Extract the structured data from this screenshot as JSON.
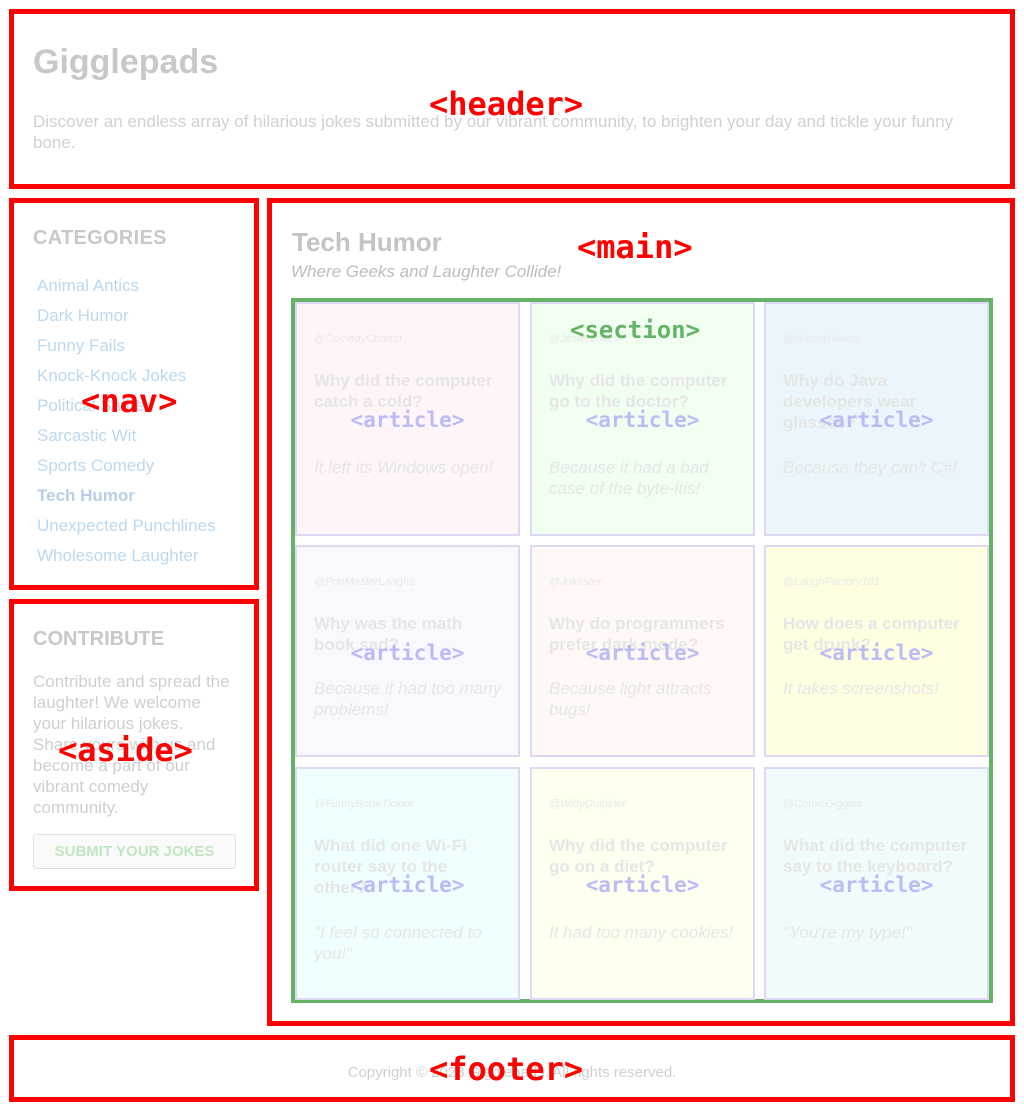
{
  "header": {
    "title": "Gigglepads",
    "tagline": "Discover an endless array of hilarious jokes submitted by our vibrant community, to brighten your day and tickle your funny bone.",
    "tag": "<header>"
  },
  "nav": {
    "heading": "CATEGORIES",
    "tag": "<nav>",
    "items": [
      {
        "label": "Animal Antics"
      },
      {
        "label": "Dark Humor"
      },
      {
        "label": "Funny Fails"
      },
      {
        "label": "Knock-Knock Jokes"
      },
      {
        "label": "Political Satire"
      },
      {
        "label": "Sarcastic Wit"
      },
      {
        "label": "Sports Comedy"
      },
      {
        "label": "Tech Humor"
      },
      {
        "label": "Unexpected Punchlines"
      },
      {
        "label": "Wholesome Laughter"
      }
    ],
    "active_index": 7
  },
  "aside": {
    "heading": "CONTRIBUTE",
    "text": "Contribute and spread the laughter! We welcome your hilarious jokes. Share yours with us and become a part of our vibrant comedy community.",
    "button_label": "SUBMIT YOUR JOKES",
    "tag": "<aside>"
  },
  "main": {
    "title": "Tech Humor",
    "subtitle": "Where Geeks and Laughter Collide!",
    "tag": "<main>",
    "section_tag": "<section>",
    "article_tag": "<article>",
    "jokes": [
      {
        "author": "@ComedyChamp",
        "question": "Why did the computer catch a cold?",
        "answer": "It left its Windows open!",
        "bg": "#fff5f8"
      },
      {
        "author": "@JesterJokes",
        "question": "Why did the computer go to the doctor?",
        "answer": "Because it had a bad case of the byte-itis!",
        "bg": "#f0fff0"
      },
      {
        "author": "@HumorHavoc",
        "question": "Why do Java developers wear glasses?",
        "answer": "Because they can't C#!",
        "bg": "#eaf6fc"
      },
      {
        "author": "@PunMasterLaughs",
        "question": "Why was the math book sad?",
        "answer": "Because it had too many problems!",
        "bg": "#f9f8ff"
      },
      {
        "author": "@Jokester",
        "question": "Why do programmers prefer dark mode?",
        "answer": "Because light attracts bugs!",
        "bg": "#fff8f4"
      },
      {
        "author": "@LaughFactory101",
        "question": "How does a computer get drunk?",
        "answer": "It takes screenshots!",
        "bg": "#fffee0"
      },
      {
        "author": "@FunnyBoneTickler",
        "question": "What did one Wi-Fi router say to the other?",
        "answer": "\"I feel so connected to you!\"",
        "bg": "#effeff"
      },
      {
        "author": "@WittyQuipster",
        "question": "Why did the computer go on a diet?",
        "answer": "It had too many cookies!",
        "bg": "#fffff0"
      },
      {
        "author": "@ComicGiggles",
        "question": "What did the computer say to the keyboard?",
        "answer": "\"You're my type!\"",
        "bg": "#f0fbfc"
      }
    ]
  },
  "footer": {
    "copyright": "Copyright © 2023 Gigglepads. All rights reserved.",
    "tag": "<footer>"
  }
}
